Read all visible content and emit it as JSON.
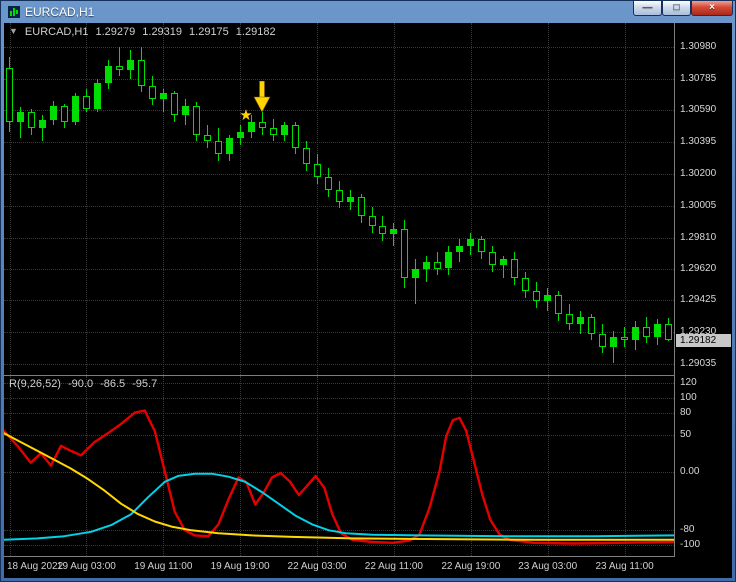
{
  "window": {
    "title": "EURCAD,H1",
    "controls": {
      "minimize": "—",
      "restore": "□",
      "close": "×"
    }
  },
  "main_header": {
    "menu_arrow": "▼",
    "symbol": "EURCAD,H1",
    "ohlc": [
      "1.29279",
      "1.29319",
      "1.29175",
      "1.29182"
    ]
  },
  "indicator_header": {
    "name": "R(9,26,52)",
    "values": [
      "-90.0",
      "-86.5",
      "-95.7"
    ]
  },
  "price_tag": "1.29182",
  "time_axis_labels": [
    "18 Aug 2022",
    "19 Aug 03:00",
    "19 Aug 11:00",
    "19 Aug 19:00",
    "22 Aug 03:00",
    "22 Aug 11:00",
    "22 Aug 19:00",
    "23 Aug 03:00",
    "23 Aug 11:00"
  ],
  "colors": {
    "background": "#000000",
    "grid": "#383838",
    "candle": "#00dd00",
    "bull_fill": "#00dd00",
    "bear_fill": "#000000",
    "red_line": "#e50000",
    "cyan_line": "#00d2e8",
    "yellow_line": "#ffd800",
    "annotation": "#ffd400",
    "axis_text": "#d8d8d8",
    "titlebar_blue": "#3f6da8",
    "price_tag_bg": "#c8c8c8"
  },
  "chart_data": {
    "type": "candlestick",
    "symbol": "EURCAD",
    "timeframe": "H1",
    "main_pane": {
      "price_max": 1.31126,
      "price_min": 1.28967,
      "grid_prices": [
        1.3098,
        1.30785,
        1.3059,
        1.30395,
        1.302,
        1.30005,
        1.2981,
        1.2962,
        1.29425,
        1.2923,
        1.29035
      ],
      "current_price": 1.29182,
      "candles_ohlc": [
        [
          1.3085,
          1.3092,
          1.3046,
          1.3052
        ],
        [
          1.3052,
          1.3061,
          1.3042,
          1.3058
        ],
        [
          1.3058,
          1.306,
          1.3044,
          1.3048
        ],
        [
          1.3048,
          1.3056,
          1.304,
          1.3053
        ],
        [
          1.3053,
          1.3065,
          1.305,
          1.3062
        ],
        [
          1.3062,
          1.3063,
          1.3048,
          1.3052
        ],
        [
          1.3052,
          1.307,
          1.305,
          1.3068
        ],
        [
          1.3068,
          1.3072,
          1.3058,
          1.306
        ],
        [
          1.306,
          1.3078,
          1.3058,
          1.3076
        ],
        [
          1.3076,
          1.309,
          1.3072,
          1.3086
        ],
        [
          1.3086,
          1.3098,
          1.308,
          1.3084
        ],
        [
          1.3084,
          1.3096,
          1.3078,
          1.309
        ],
        [
          1.309,
          1.3098,
          1.307,
          1.3074
        ],
        [
          1.3074,
          1.308,
          1.3062,
          1.3066
        ],
        [
          1.3066,
          1.3072,
          1.3058,
          1.307
        ],
        [
          1.307,
          1.3071,
          1.3052,
          1.3056
        ],
        [
          1.3056,
          1.3066,
          1.305,
          1.3062
        ],
        [
          1.3062,
          1.3064,
          1.304,
          1.3044
        ],
        [
          1.3044,
          1.305,
          1.3036,
          1.304
        ],
        [
          1.304,
          1.3048,
          1.3028,
          1.3032
        ],
        [
          1.3032,
          1.3044,
          1.3028,
          1.3042
        ],
        [
          1.3042,
          1.305,
          1.3038,
          1.3046
        ],
        [
          1.3046,
          1.3056,
          1.3042,
          1.3052
        ],
        [
          1.3052,
          1.3058,
          1.3044,
          1.3048
        ],
        [
          1.3048,
          1.3054,
          1.304,
          1.3044
        ],
        [
          1.3044,
          1.3052,
          1.304,
          1.305
        ],
        [
          1.305,
          1.3052,
          1.3032,
          1.3036
        ],
        [
          1.3036,
          1.304,
          1.3022,
          1.3026
        ],
        [
          1.3026,
          1.3032,
          1.3014,
          1.3018
        ],
        [
          1.3018,
          1.3024,
          1.3006,
          1.301
        ],
        [
          1.301,
          1.3016,
          1.2999,
          1.3003
        ],
        [
          1.3003,
          1.301,
          1.2998,
          1.3006
        ],
        [
          1.3006,
          1.3008,
          1.299,
          1.2994
        ],
        [
          1.2994,
          1.3,
          1.2984,
          1.2988
        ],
        [
          1.2988,
          1.2994,
          1.2979,
          1.2983
        ],
        [
          1.2983,
          1.299,
          1.2976,
          1.2986
        ],
        [
          1.2986,
          1.2992,
          1.295,
          1.2956
        ],
        [
          1.2956,
          1.2968,
          1.294,
          1.2962
        ],
        [
          1.2962,
          1.297,
          1.2954,
          1.2966
        ],
        [
          1.2966,
          1.2972,
          1.2958,
          1.2962
        ],
        [
          1.2962,
          1.2976,
          1.2958,
          1.2972
        ],
        [
          1.2972,
          1.298,
          1.2966,
          1.2976
        ],
        [
          1.2976,
          1.2984,
          1.297,
          1.298
        ],
        [
          1.298,
          1.2982,
          1.2968,
          1.2972
        ],
        [
          1.2972,
          1.2976,
          1.296,
          1.2964
        ],
        [
          1.2964,
          1.297,
          1.2956,
          1.2968
        ],
        [
          1.2968,
          1.2972,
          1.2952,
          1.2956
        ],
        [
          1.2956,
          1.296,
          1.2944,
          1.2948
        ],
        [
          1.2948,
          1.2954,
          1.2938,
          1.2942
        ],
        [
          1.2942,
          1.295,
          1.2936,
          1.2946
        ],
        [
          1.2946,
          1.2948,
          1.293,
          1.2934
        ],
        [
          1.2934,
          1.294,
          1.2924,
          1.2928
        ],
        [
          1.2928,
          1.2936,
          1.2922,
          1.2932
        ],
        [
          1.2932,
          1.2934,
          1.2918,
          1.2922
        ],
        [
          1.2922,
          1.2928,
          1.291,
          1.2914
        ],
        [
          1.2914,
          1.2924,
          1.2904,
          1.292
        ],
        [
          1.292,
          1.2926,
          1.2914,
          1.2918
        ],
        [
          1.2918,
          1.293,
          1.2912,
          1.2926
        ],
        [
          1.2926,
          1.2932,
          1.2916,
          1.292
        ],
        [
          1.292,
          1.2931,
          1.2915,
          1.29279
        ],
        [
          1.29279,
          1.29319,
          1.29175,
          1.29182
        ]
      ]
    },
    "annotations": {
      "arrow": {
        "bar_index": 23,
        "price": 1.3058
      },
      "star": {
        "bar_index": 22.2,
        "price": 1.3056,
        "glyph": "★"
      }
    },
    "indicator_pane": {
      "name": "R(9,26,52)",
      "current_values": [
        -90.0,
        -86.5,
        -95.7
      ],
      "value_max": 130,
      "value_min": -115,
      "axis": [
        {
          "label": "120",
          "value": 120
        },
        {
          "label": "100",
          "value": 100
        },
        {
          "label": "80",
          "value": 80
        },
        {
          "label": "50",
          "value": 50
        },
        {
          "label": "0.00",
          "value": 0
        },
        {
          "label": "-80",
          "value": -80
        },
        {
          "label": "-100",
          "value": -100
        }
      ],
      "series": [
        {
          "name": "red",
          "color": "#e50000",
          "width": 2.4,
          "points": [
            [
              0,
              55
            ],
            [
              0.02,
              35
            ],
            [
              0.04,
              12
            ],
            [
              0.055,
              25
            ],
            [
              0.07,
              8
            ],
            [
              0.085,
              35
            ],
            [
              0.1,
              28
            ],
            [
              0.115,
              22
            ],
            [
              0.135,
              40
            ],
            [
              0.155,
              52
            ],
            [
              0.175,
              65
            ],
            [
              0.195,
              80
            ],
            [
              0.21,
              83
            ],
            [
              0.225,
              55
            ],
            [
              0.24,
              0
            ],
            [
              0.255,
              -55
            ],
            [
              0.27,
              -80
            ],
            [
              0.285,
              -87
            ],
            [
              0.305,
              -88
            ],
            [
              0.32,
              -72
            ],
            [
              0.335,
              -38
            ],
            [
              0.35,
              -8
            ],
            [
              0.362,
              -15
            ],
            [
              0.375,
              -45
            ],
            [
              0.388,
              -28
            ],
            [
              0.4,
              -8
            ],
            [
              0.413,
              -2
            ],
            [
              0.427,
              -14
            ],
            [
              0.44,
              -32
            ],
            [
              0.452,
              -20
            ],
            [
              0.465,
              -6
            ],
            [
              0.478,
              -22
            ],
            [
              0.49,
              -58
            ],
            [
              0.503,
              -84
            ],
            [
              0.52,
              -93
            ],
            [
              0.55,
              -96
            ],
            [
              0.58,
              -97
            ],
            [
              0.605,
              -94
            ],
            [
              0.62,
              -86
            ],
            [
              0.635,
              -50
            ],
            [
              0.65,
              0
            ],
            [
              0.66,
              48
            ],
            [
              0.67,
              70
            ],
            [
              0.68,
              73
            ],
            [
              0.69,
              55
            ],
            [
              0.702,
              12
            ],
            [
              0.714,
              -32
            ],
            [
              0.726,
              -66
            ],
            [
              0.74,
              -86
            ],
            [
              0.755,
              -93
            ],
            [
              0.79,
              -97
            ],
            [
              0.85,
              -98
            ],
            [
              0.92,
              -97
            ],
            [
              1,
              -96
            ]
          ]
        },
        {
          "name": "cyan",
          "color": "#00d2e8",
          "width": 2,
          "points": [
            [
              0,
              -93
            ],
            [
              0.05,
              -91
            ],
            [
              0.09,
              -88
            ],
            [
              0.13,
              -82
            ],
            [
              0.16,
              -73
            ],
            [
              0.19,
              -58
            ],
            [
              0.215,
              -35
            ],
            [
              0.24,
              -14
            ],
            [
              0.26,
              -6
            ],
            [
              0.285,
              -3
            ],
            [
              0.31,
              -3
            ],
            [
              0.335,
              -7
            ],
            [
              0.36,
              -14
            ],
            [
              0.385,
              -28
            ],
            [
              0.41,
              -44
            ],
            [
              0.435,
              -60
            ],
            [
              0.46,
              -72
            ],
            [
              0.485,
              -80
            ],
            [
              0.51,
              -84
            ],
            [
              0.55,
              -86
            ],
            [
              0.62,
              -87
            ],
            [
              0.75,
              -88
            ],
            [
              0.88,
              -88
            ],
            [
              1,
              -87
            ]
          ]
        },
        {
          "name": "yellow",
          "color": "#ffd800",
          "width": 2,
          "points": [
            [
              0,
              52
            ],
            [
              0.025,
              40
            ],
            [
              0.05,
              28
            ],
            [
              0.075,
              16
            ],
            [
              0.1,
              4
            ],
            [
              0.125,
              -10
            ],
            [
              0.15,
              -26
            ],
            [
              0.175,
              -44
            ],
            [
              0.2,
              -58
            ],
            [
              0.225,
              -68
            ],
            [
              0.25,
              -75
            ],
            [
              0.28,
              -80
            ],
            [
              0.32,
              -84
            ],
            [
              0.37,
              -87
            ],
            [
              0.43,
              -89
            ],
            [
              0.52,
              -91
            ],
            [
              0.65,
              -92
            ],
            [
              0.8,
              -93
            ],
            [
              1,
              -93
            ]
          ]
        }
      ]
    },
    "time_labels_every_n_bars": 7
  }
}
